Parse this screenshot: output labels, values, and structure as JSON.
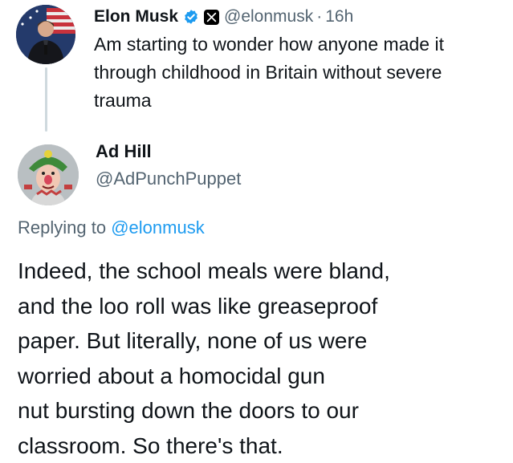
{
  "parent_tweet": {
    "author_name": "Elon Musk",
    "handle": "@elonmusk",
    "separator": "·",
    "time": "16h",
    "text": "Am starting to wonder how anyone made it through childhood in Britain without severe trauma",
    "verified_icon": "verified-badge-icon",
    "affiliate_icon": "x-logo-icon"
  },
  "reply": {
    "author_name": "Ad Hill",
    "handle": "@AdPunchPuppet",
    "replying_prefix": "Replying to",
    "replying_mention": "@elonmusk",
    "text_lines": [
      "Indeed, the school meals were bland,",
      "and the loo roll was like greaseproof",
      "paper. But literally, none of us were",
      "worried about a homocidal gun",
      "nut bursting down the doors to our",
      "classroom. So there's that."
    ]
  },
  "colors": {
    "text": "#0f1419",
    "secondary_text": "#536471",
    "link": "#1d9bf0",
    "verified": "#1d9bf0",
    "thread_line": "#cfd9de"
  }
}
